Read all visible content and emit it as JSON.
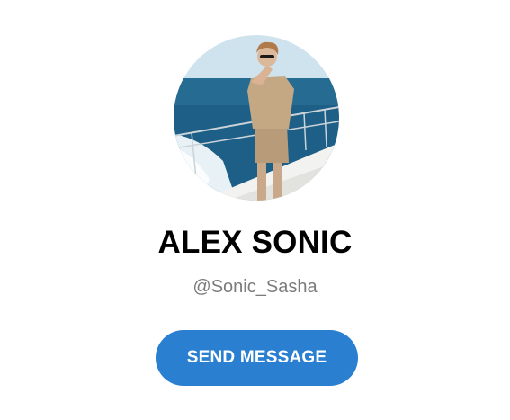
{
  "profile": {
    "avatar_icon": "profile-photo",
    "name": "ALEX SONIC",
    "username": "@Sonic_Sasha",
    "send_label": "SEND MESSAGE"
  },
  "colors": {
    "accent": "#2a7fd0",
    "name_text": "#000000",
    "username_text": "#7b7b7b",
    "button_text": "#ffffff"
  }
}
